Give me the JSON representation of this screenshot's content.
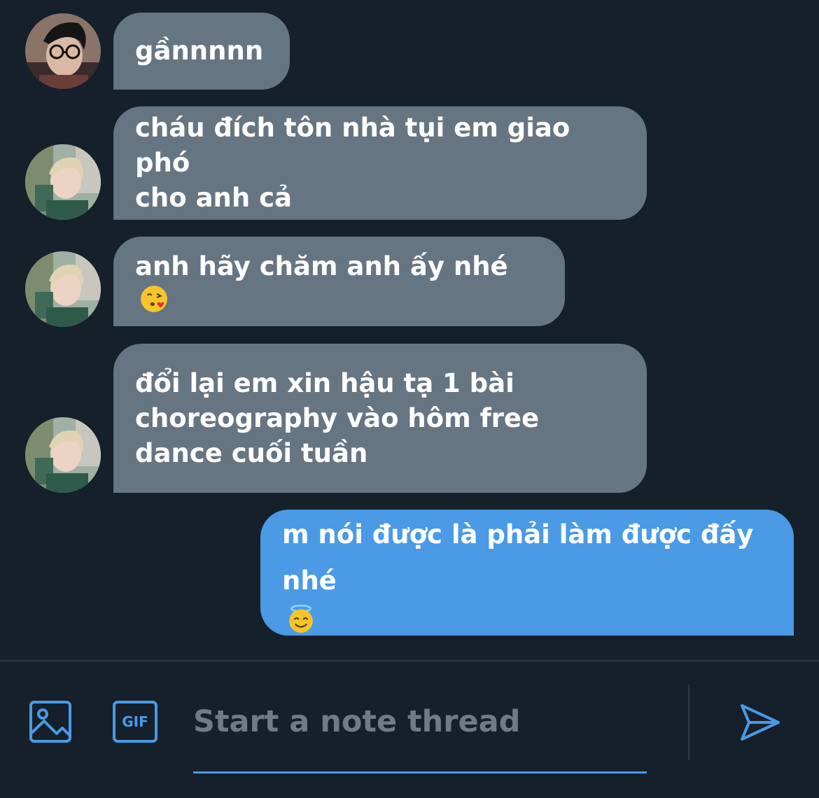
{
  "messages": [
    {
      "id": "m1",
      "sender": "other",
      "avatar": "avatar-glasses",
      "lines": [
        "gầnnnnn"
      ],
      "emoji": ""
    },
    {
      "id": "m2",
      "sender": "other",
      "avatar": "avatar-blond",
      "lines": [
        "cháu đích tôn nhà tụi em giao phó",
        "cho anh cả"
      ],
      "emoji": ""
    },
    {
      "id": "m3",
      "sender": "other",
      "avatar": "avatar-blond",
      "lines": [
        "anh hãy chăm anh ấy nhé"
      ],
      "emoji": "face-blowing-kiss"
    },
    {
      "id": "m4",
      "sender": "other",
      "avatar": "avatar-blond",
      "lines": [
        "đổi lại em xin hậu tạ 1 bài",
        "choreography vào hôm free",
        "dance cuối tuần"
      ],
      "emoji": ""
    },
    {
      "id": "m5",
      "sender": "self",
      "avatar": "",
      "lines": [
        "m nói được là phải làm được đấy",
        "nhé"
      ],
      "emoji": "smiling-face-with-halo"
    }
  ],
  "composer": {
    "placeholder": "Start a note thread",
    "value": "",
    "media_icon": "image-icon",
    "gif_label": "GIF",
    "send_icon": "send-icon"
  },
  "colors": {
    "background": "#15202b",
    "incoming_bubble": "#667582",
    "outgoing_bubble": "#4a9ae6",
    "accent": "#4a9ae6"
  }
}
